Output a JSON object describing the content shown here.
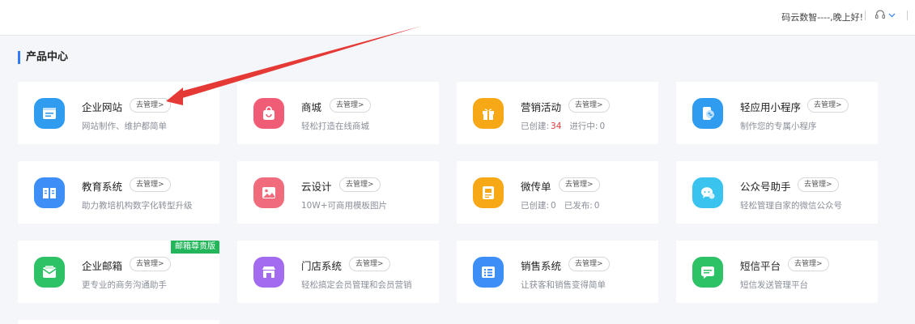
{
  "header": {
    "greeting": "码云数智----,晚上好!"
  },
  "section": {
    "title": "产品中心"
  },
  "manage_label": "去管理>",
  "colors": {
    "accent": "#2f7cf6",
    "ribbon": "#21b65a",
    "highlight_number": "#e23b3b",
    "arrow": "#e53935"
  },
  "cards": [
    {
      "name": "企业网站",
      "desc": "网站制作、维护都简单",
      "icon": "website-icon",
      "icon_color": "#2f9cf0"
    },
    {
      "name": "商城",
      "desc": "轻松打造在线商城",
      "icon": "shop-bag-icon",
      "icon_color": "#f05c76"
    },
    {
      "name": "营销活动",
      "desc_created_label": "已创建:",
      "desc_created_value": "34",
      "desc_running_label": "进行中:",
      "desc_running_value": "0",
      "icon": "gift-icon",
      "icon_color": "#f7a816"
    },
    {
      "name": "轻应用小程序",
      "desc": "制作您的专属小程序",
      "icon": "miniapp-icon",
      "icon_color": "#2f9cf0"
    },
    {
      "name": "教育系统",
      "desc": "助力教培机构数字化转型升级",
      "icon": "book-icon",
      "icon_color": "#3d8ef7"
    },
    {
      "name": "云设计",
      "desc": "10W+可商用模板图片",
      "icon": "image-icon",
      "icon_color": "#f06b7b"
    },
    {
      "name": "微传单",
      "desc_created_label": "已创建:",
      "desc_created_value": "0",
      "desc_published_label": "已发布:",
      "desc_published_value": "0",
      "icon": "flyer-icon",
      "icon_color": "#f7a816"
    },
    {
      "name": "公众号助手",
      "desc": "轻松管理自家的微信公众号",
      "icon": "wechat-icon",
      "icon_color": "#3bc3ef"
    },
    {
      "name": "企业邮箱",
      "desc": "更专业的商务沟通助手",
      "icon": "mail-icon",
      "icon_color": "#2ec266",
      "ribbon": "邮箱尊贵版"
    },
    {
      "name": "门店系统",
      "desc": "轻松搞定会员管理和会员营销",
      "icon": "store-icon",
      "icon_color": "#a36cf0"
    },
    {
      "name": "销售系统",
      "desc": "让获客和销售变得简单",
      "icon": "list-icon",
      "icon_color": "#3d8ef7"
    },
    {
      "name": "短信平台",
      "desc": "短信发送管理平台",
      "icon": "sms-icon",
      "icon_color": "#2ec266"
    }
  ]
}
